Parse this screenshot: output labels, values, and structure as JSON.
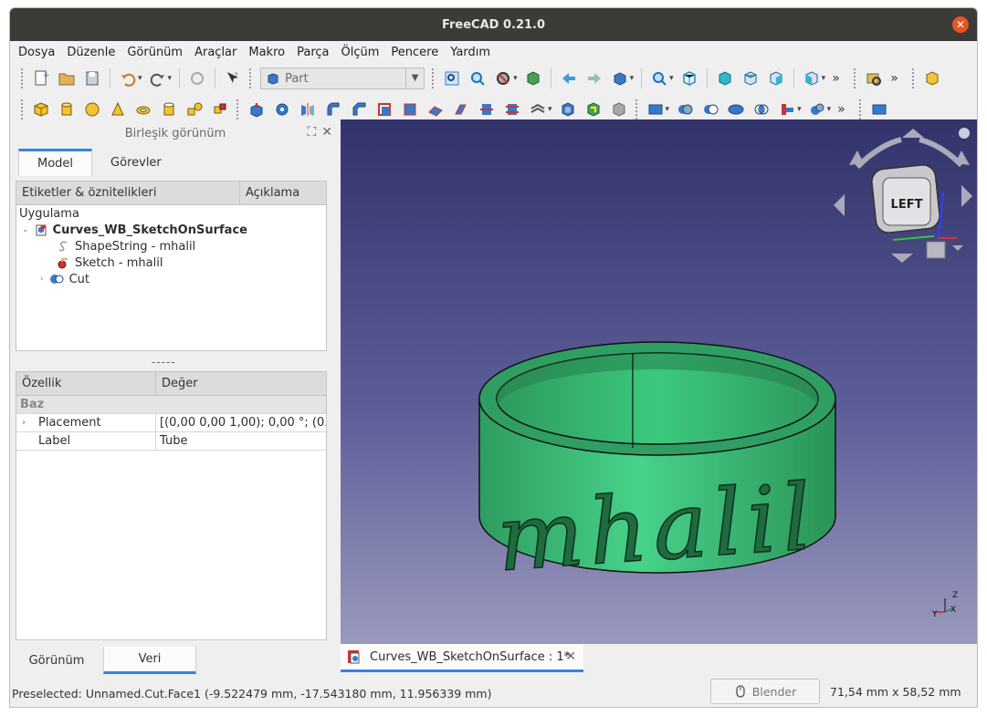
{
  "window": {
    "title": "FreeCAD 0.21.0",
    "close_glyph": "✕"
  },
  "menu": [
    "Dosya",
    "Düzenle",
    "Görünüm",
    "Araçlar",
    "Makro",
    "Parça",
    "Ölçüm",
    "Pencere",
    "Yardım"
  ],
  "workbench": {
    "selected": "Part",
    "icon": "part-cube-icon"
  },
  "toolbar_overflow_glyph": "»",
  "combo_view": {
    "title": "Birleşik görünüm",
    "tabs": [
      "Model",
      "Görevler"
    ],
    "active_tab": "Model"
  },
  "tree": {
    "columns": [
      "Etiketler & öznitelikleri",
      "Açıklama"
    ],
    "root_label": "Uygulama",
    "document": "Curves_WB_SketchOnSurface",
    "items": [
      {
        "label": "ShapeString - mhalil",
        "icon": "shapestring-icon"
      },
      {
        "label": "Sketch - mhalil",
        "icon": "sketch-icon"
      },
      {
        "label": "Cut",
        "icon": "cut-icon"
      }
    ]
  },
  "splitter_glyph": "-----",
  "properties": {
    "columns": [
      "Özellik",
      "Değer"
    ],
    "group": "Baz",
    "rows": [
      {
        "name": "Placement",
        "value": "[(0,00 0,00 1,00); 0,00 °; (0..."
      },
      {
        "name": "Label",
        "value": "Tube"
      }
    ]
  },
  "bottom_tabs": [
    "Görünüm",
    "Veri"
  ],
  "active_bottom_tab": "Veri",
  "viewport": {
    "engraved_text": "mhalil",
    "navcube_face": "LEFT",
    "axis_labels": {
      "x": "X",
      "y": "Y",
      "z": "Z"
    },
    "colors": {
      "model": "#3cc87e",
      "model_dark": "#25874f",
      "bg_top": "#33336b",
      "bg_bottom": "#9999bd"
    }
  },
  "document_tab": {
    "label": "Curves_WB_SketchOnSurface : 1*",
    "close_glyph": "✕"
  },
  "status": {
    "message": "Preselected: Unnamed.Cut.Face1 (-9.522479 mm, -17.543180 mm, 11.956339 mm)",
    "navigation_style": "Blender",
    "dimensions": "71,54 mm x 58,52 mm"
  },
  "colors": {
    "accent": "#3583e0",
    "titlebar": "#3c3b37",
    "close": "#e95420"
  }
}
